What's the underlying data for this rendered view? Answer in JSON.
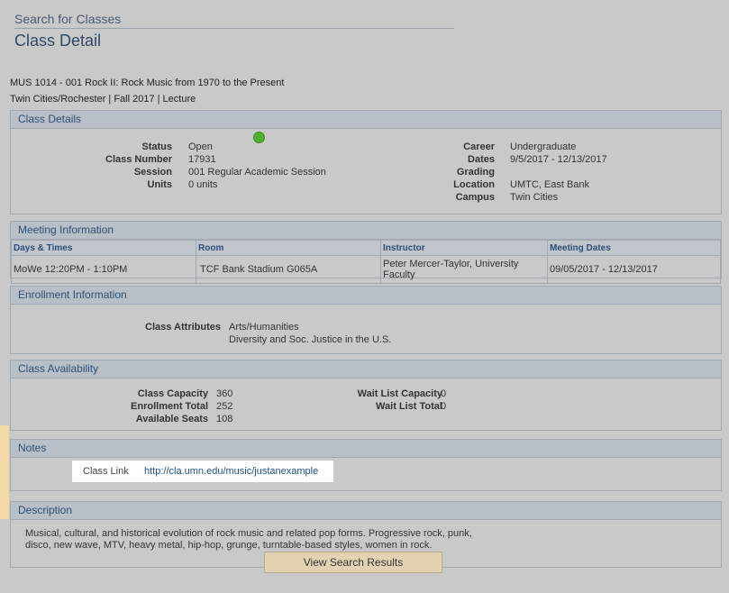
{
  "breadcrumb": "Search for Classes",
  "page_title": "Class Detail",
  "class_header": {
    "line1": "MUS 1014 - 001   Rock II: Rock Music from 1970 to the Present",
    "line2": "Twin Cities/Rochester | Fall 2017 | Lecture"
  },
  "class_details": {
    "header": "Class Details",
    "status_label": "Status",
    "status_value": "Open",
    "class_number_label": "Class Number",
    "class_number_value": "17931",
    "session_label": "Session",
    "session_value": "001 Regular Academic Session",
    "units_label": "Units",
    "units_value": "0 units",
    "career_label": "Career",
    "career_value": "Undergraduate",
    "dates_label": "Dates",
    "dates_value": "9/5/2017 - 12/13/2017",
    "grading_label": "Grading",
    "grading_value": "",
    "location_label": "Location",
    "location_value": "UMTC, East Bank",
    "campus_label": "Campus",
    "campus_value": "Twin Cities",
    "status_color": "#4fb02b"
  },
  "meeting": {
    "header": "Meeting Information",
    "columns": [
      "Days & Times",
      "Room",
      "Instructor",
      "Meeting Dates"
    ],
    "row": {
      "days_times": "MoWe 12:20PM - 1:10PM",
      "room": "TCF Bank Stadium G065A",
      "instructor": "Peter Mercer-Taylor, University Faculty",
      "meeting_dates": "09/05/2017 - 12/13/2017"
    }
  },
  "enrollment": {
    "header": "Enrollment Information",
    "attributes_label": "Class Attributes",
    "attribute_1": "Arts/Humanities",
    "attribute_2": "Diversity and Soc. Justice in the U.S."
  },
  "availability": {
    "header": "Class Availability",
    "capacity_label": "Class Capacity",
    "capacity_value": "360",
    "enrollment_total_label": "Enrollment Total",
    "enrollment_total_value": "252",
    "available_seats_label": "Available Seats",
    "available_seats_value": "108",
    "waitlist_capacity_label": "Wait List Capacity",
    "waitlist_capacity_value": "0",
    "waitlist_total_label": "Wait List Total",
    "waitlist_total_value": "0"
  },
  "notes": {
    "header": "Notes",
    "class_link_label": "Class Link",
    "class_link_url": "http://cla.umn.edu/music/justanexample"
  },
  "description": {
    "header": "Description",
    "text": "Musical, cultural, and historical evolution of rock music and related pop forms. Progressive rock, punk, disco, new wave, MTV, heavy metal, hip-hop, grunge, turntable-based styles, women in rock."
  },
  "actions": {
    "view_search_results": "View Search Results"
  }
}
